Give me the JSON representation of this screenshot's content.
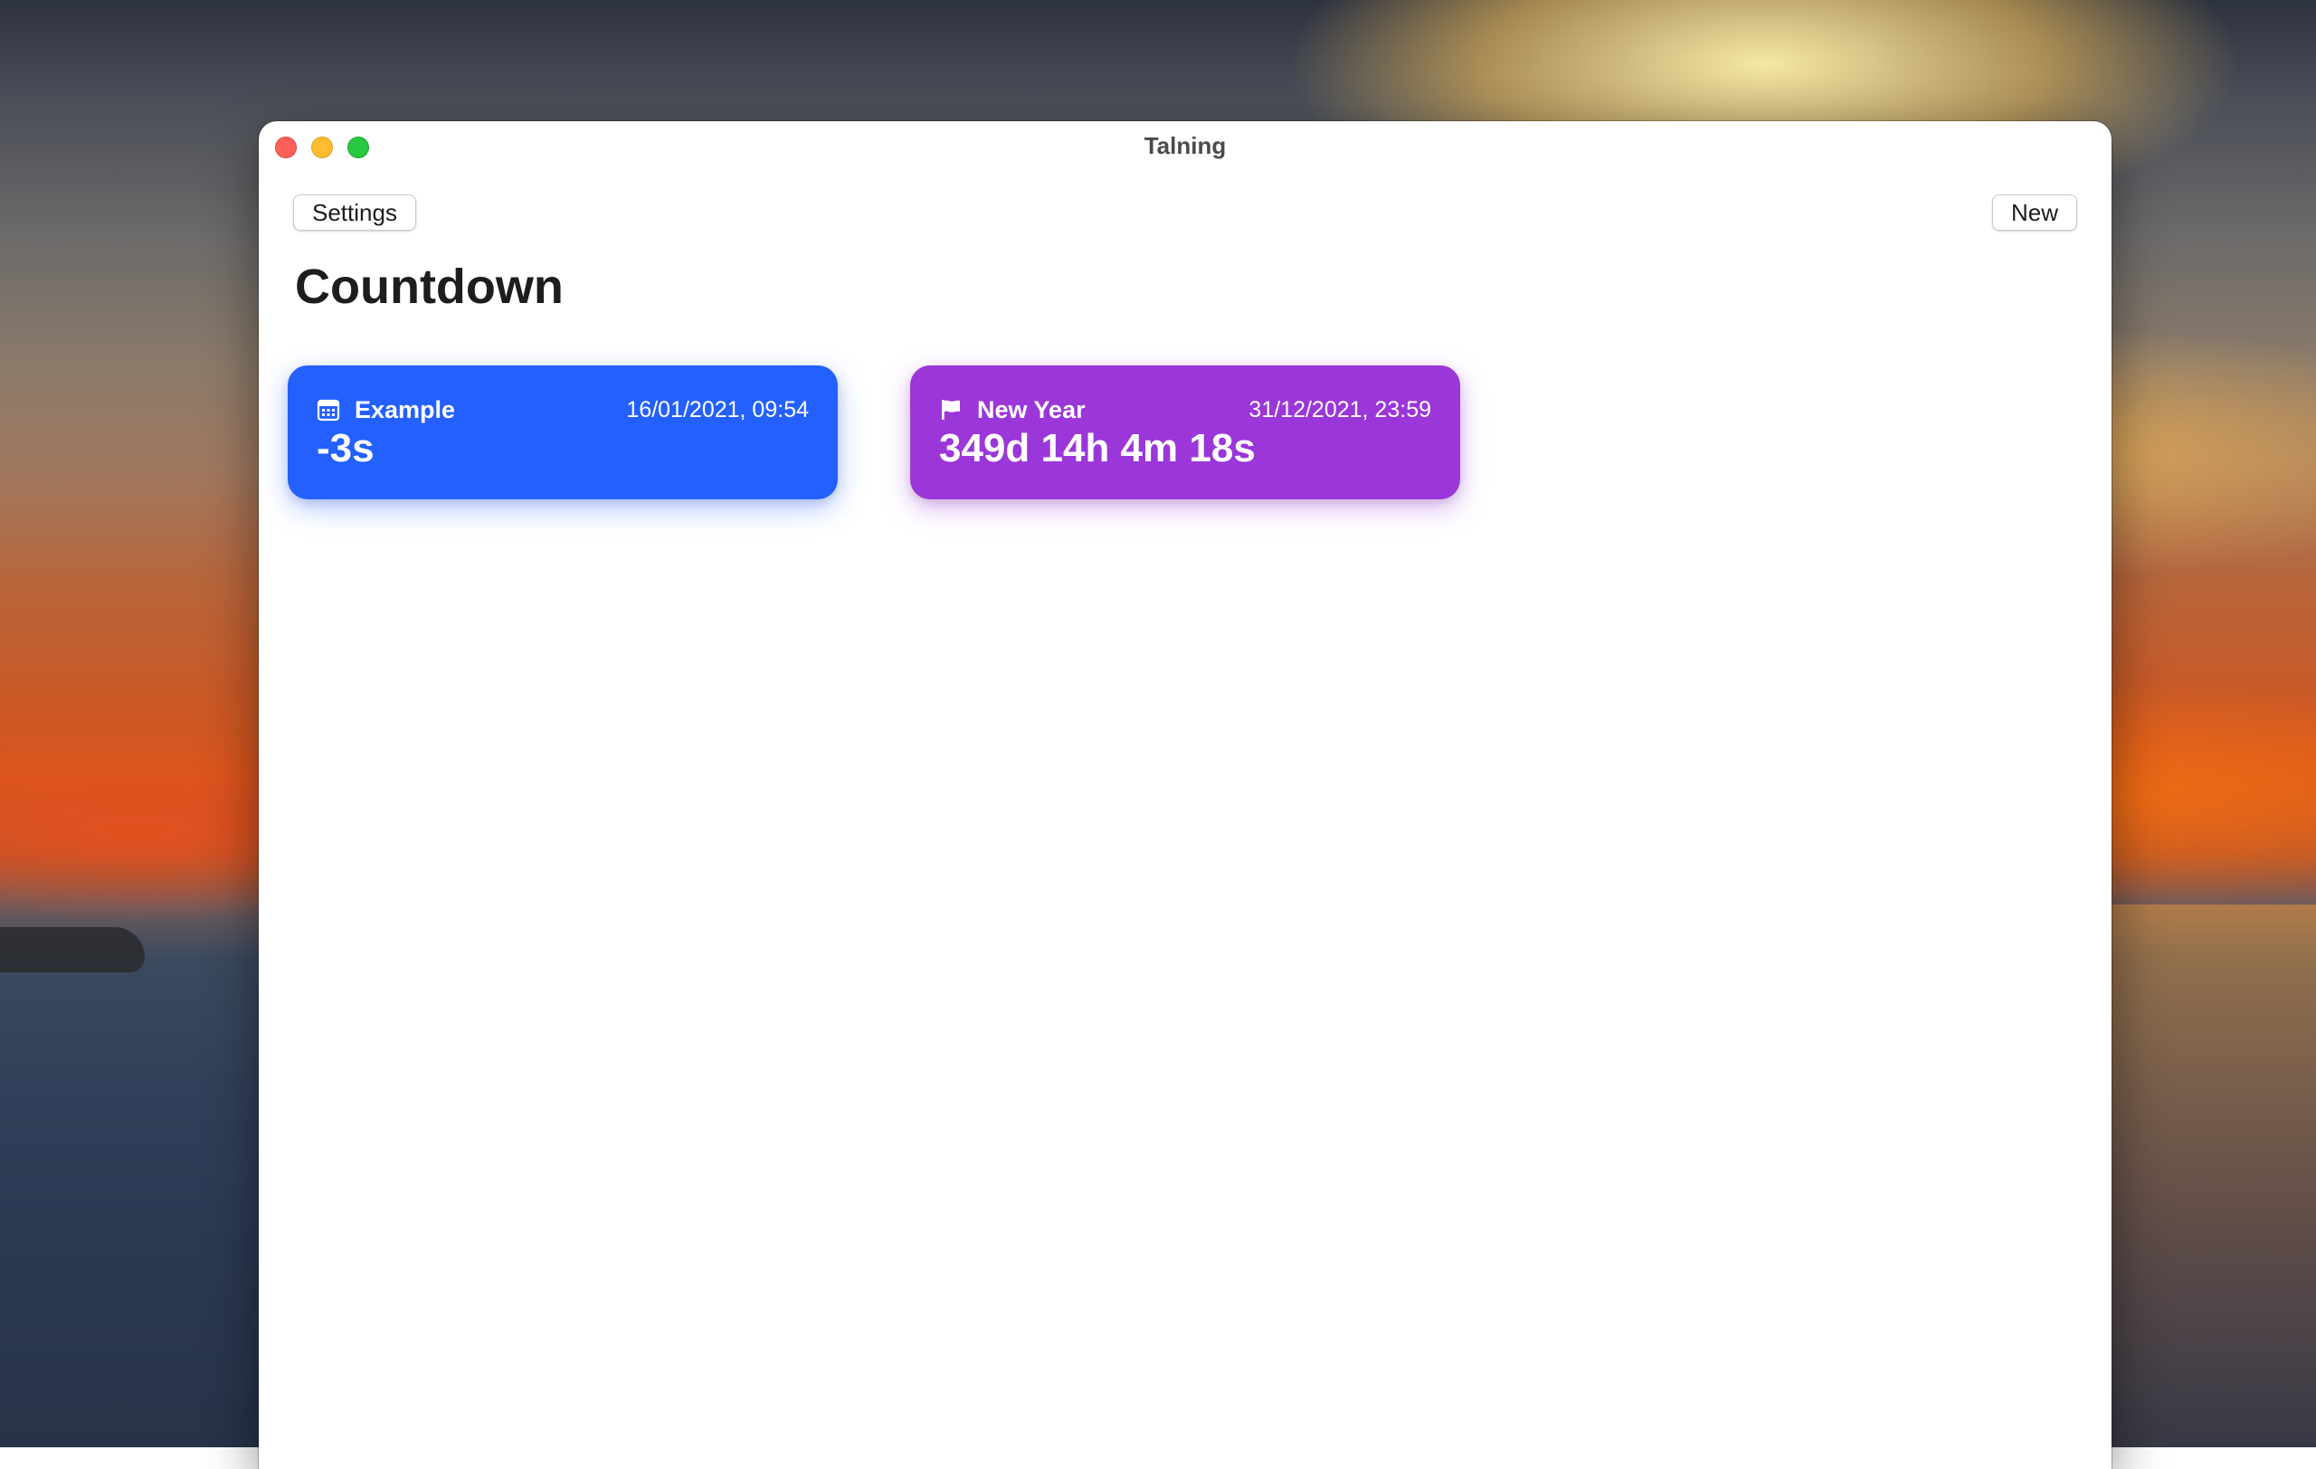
{
  "app": {
    "window_title": "Talning"
  },
  "toolbar": {
    "settings_label": "Settings",
    "new_label": "New"
  },
  "main": {
    "title": "Countdown",
    "cards": [
      {
        "name": "Example",
        "date": "16/01/2021, 09:54",
        "countdown": "-3s",
        "icon": "calendar-icon",
        "color": "#2360fe"
      },
      {
        "name": "New Year",
        "date": "31/12/2021, 23:59",
        "countdown": "349d 14h 4m 18s",
        "icon": "flag-icon",
        "color": "#9b36d9"
      }
    ]
  },
  "colors": {
    "close": "#fe5f57",
    "minimize": "#febc2e",
    "maximize": "#28c840"
  }
}
